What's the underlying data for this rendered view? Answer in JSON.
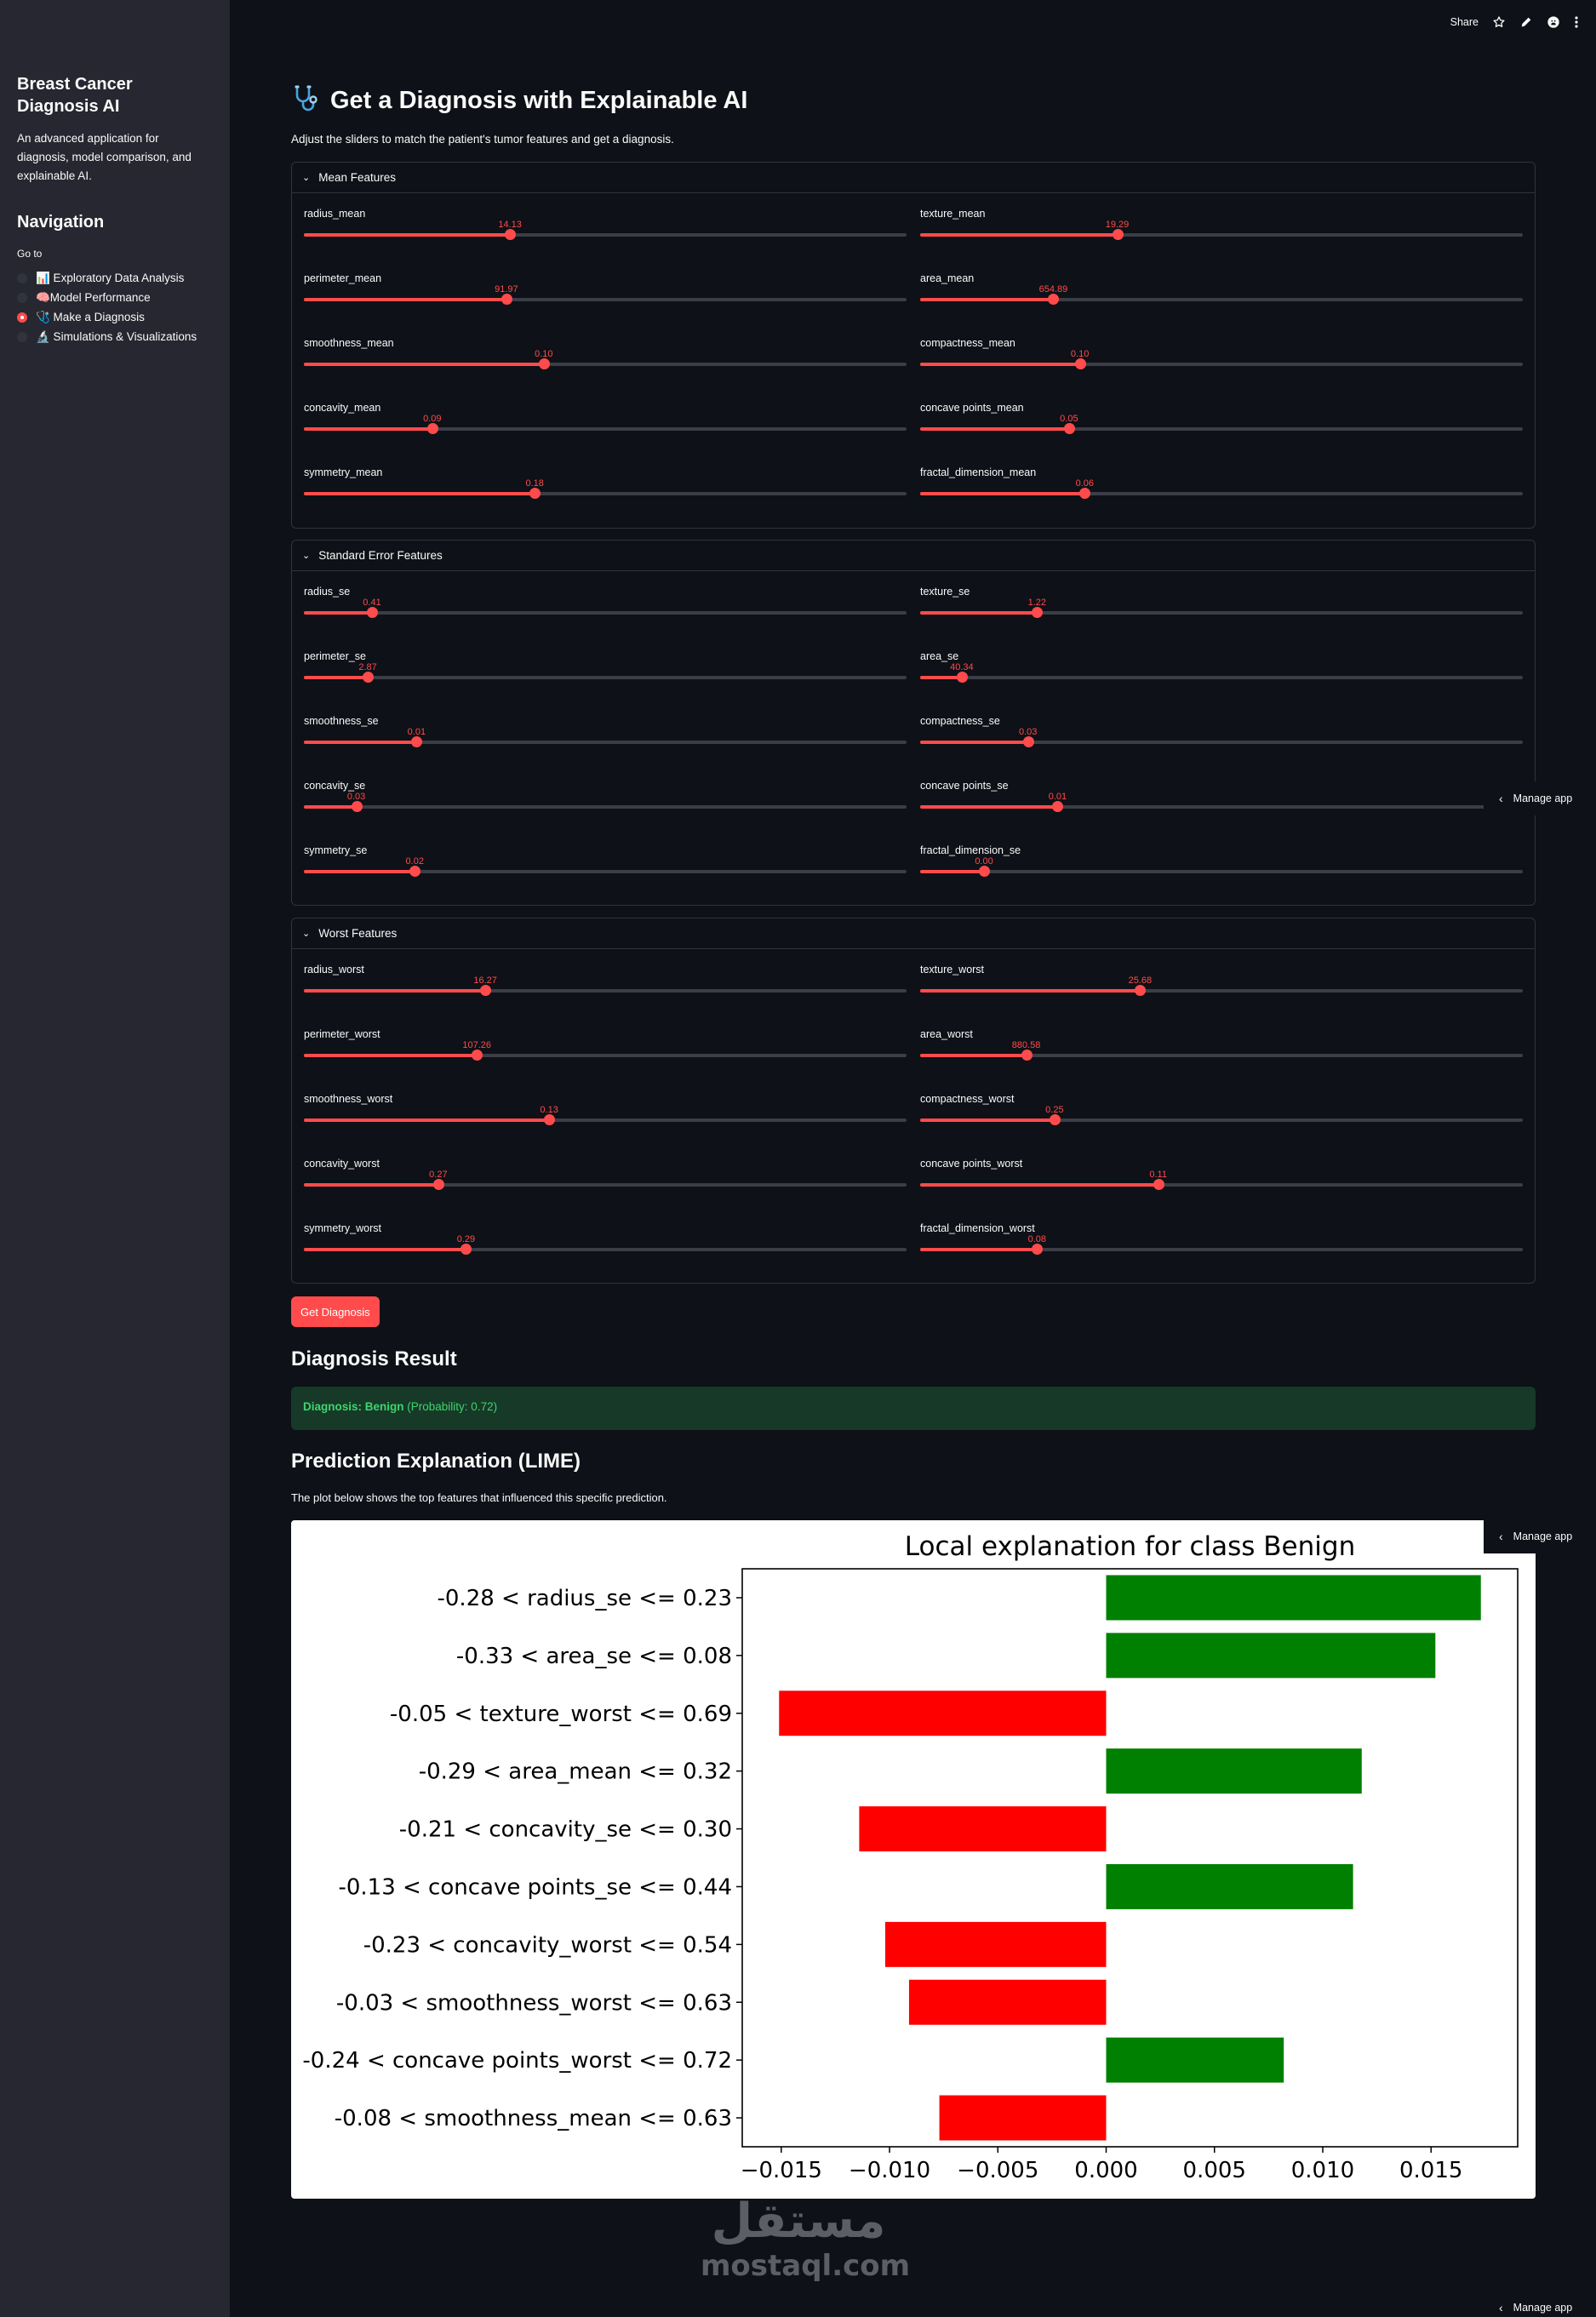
{
  "sidebar": {
    "title": "Breast Cancer Diagnosis AI",
    "description": "An advanced application for diagnosis, model comparison, and explainable AI.",
    "nav_title": "Navigation",
    "goto_label": "Go to",
    "options": [
      {
        "label": "📊 Exploratory Data Analysis",
        "selected": false
      },
      {
        "label": "🧠Model Performance",
        "selected": false
      },
      {
        "label": "🩺 Make a Diagnosis",
        "selected": true
      },
      {
        "label": "🔬 Simulations & Visualizations",
        "selected": false
      }
    ]
  },
  "toolbar": {
    "share_label": "Share",
    "icons": [
      "star-icon",
      "edit-icon",
      "github-icon",
      "more-icon"
    ]
  },
  "header": {
    "icon": "stethoscope-icon",
    "title": "Get a Diagnosis with Explainable AI",
    "subtitle": "Adjust the sliders to match the patient's tumor features and get a diagnosis."
  },
  "sections": [
    {
      "title": "Mean Features",
      "sliders": [
        {
          "label": "radius_mean",
          "value": "14.13",
          "fraction": 0.342
        },
        {
          "label": "texture_mean",
          "value": "19.29",
          "fraction": 0.327
        },
        {
          "label": "perimeter_mean",
          "value": "91.97",
          "fraction": 0.336
        },
        {
          "label": "area_mean",
          "value": "654.89",
          "fraction": 0.221
        },
        {
          "label": "smoothness_mean",
          "value": "0.10",
          "fraction": 0.398
        },
        {
          "label": "compactness_mean",
          "value": "0.10",
          "fraction": 0.265
        },
        {
          "label": "concavity_mean",
          "value": "0.09",
          "fraction": 0.213
        },
        {
          "label": "concave points_mean",
          "value": "0.05",
          "fraction": 0.247
        },
        {
          "label": "symmetry_mean",
          "value": "0.18",
          "fraction": 0.383
        },
        {
          "label": "fractal_dimension_mean",
          "value": "0.06",
          "fraction": 0.273
        }
      ]
    },
    {
      "title": "Standard Error Features",
      "sliders": [
        {
          "label": "radius_se",
          "value": "0.41",
          "fraction": 0.113
        },
        {
          "label": "texture_se",
          "value": "1.22",
          "fraction": 0.194
        },
        {
          "label": "perimeter_se",
          "value": "2.87",
          "fraction": 0.106
        },
        {
          "label": "area_se",
          "value": "40.34",
          "fraction": 0.069
        },
        {
          "label": "smoothness_se",
          "value": "0.01",
          "fraction": 0.187
        },
        {
          "label": "compactness_se",
          "value": "0.03",
          "fraction": 0.179
        },
        {
          "label": "concavity_se",
          "value": "0.03",
          "fraction": 0.087
        },
        {
          "label": "concave points_se",
          "value": "0.01",
          "fraction": 0.228
        },
        {
          "label": "symmetry_se",
          "value": "0.02",
          "fraction": 0.184
        },
        {
          "label": "fractal_dimension_se",
          "value": "0.00",
          "fraction": 0.106
        }
      ]
    },
    {
      "title": "Worst Features",
      "sliders": [
        {
          "label": "radius_worst",
          "value": "16.27",
          "fraction": 0.301
        },
        {
          "label": "texture_worst",
          "value": "25.68",
          "fraction": 0.365
        },
        {
          "label": "perimeter_worst",
          "value": "107.26",
          "fraction": 0.287
        },
        {
          "label": "area_worst",
          "value": "880.58",
          "fraction": 0.176
        },
        {
          "label": "smoothness_worst",
          "value": "0.13",
          "fraction": 0.407
        },
        {
          "label": "compactness_worst",
          "value": "0.25",
          "fraction": 0.223
        },
        {
          "label": "concavity_worst",
          "value": "0.27",
          "fraction": 0.223
        },
        {
          "label": "concave points_worst",
          "value": "0.11",
          "fraction": 0.395
        },
        {
          "label": "symmetry_worst",
          "value": "0.29",
          "fraction": 0.269
        },
        {
          "label": "fractal_dimension_worst",
          "value": "0.08",
          "fraction": 0.194
        }
      ]
    }
  ],
  "diagnose_button": "Get Diagnosis",
  "result": {
    "heading": "Diagnosis Result",
    "diagnosis": "Diagnosis: Benign",
    "probability": "(Probability: 0.72)"
  },
  "explanation": {
    "heading": "Prediction Explanation (LIME)",
    "description": "The plot below shows the top features that influenced this specific prediction."
  },
  "chart_data": {
    "type": "bar",
    "orientation": "horizontal",
    "title": "Local explanation for class Benign",
    "xlabel": "",
    "ylabel": "",
    "categories": [
      "-0.28 < radius_se <= 0.23",
      "-0.33 < area_se <= 0.08",
      "-0.05 < texture_worst <= 0.69",
      "-0.29 < area_mean <= 0.32",
      "-0.21 < concavity_se <= 0.30",
      "-0.13 < concave points_se <= 0.44",
      "-0.23 < concavity_worst <= 0.54",
      "-0.03 < smoothness_worst <= 0.63",
      "-0.24 < concave points_worst <= 0.72",
      "-0.08 < smoothness_mean <= 0.63"
    ],
    "values": [
      0.0173,
      0.0152,
      -0.0151,
      0.0118,
      -0.0114,
      0.0114,
      -0.0102,
      -0.0091,
      0.0082,
      -0.0077
    ],
    "xlim": [
      -0.0168,
      0.019
    ],
    "xticks": [
      "−0.015",
      "−0.010",
      "−0.005",
      "0.000",
      "0.005",
      "0.010",
      "0.015"
    ],
    "xtick_values": [
      -0.015,
      -0.01,
      -0.005,
      0,
      0.005,
      0.01,
      0.015
    ],
    "positive_color": "#008000",
    "negative_color": "#ff0000",
    "grid": false
  },
  "manage_app_label": "Manage app",
  "watermark": {
    "arabic": "مستقل",
    "latin": "mostaql.com"
  },
  "colors": {
    "accent": "#ff4b4b",
    "background": "#0e1117",
    "sidebar": "#262730",
    "success_bg": "#173928",
    "success_text": "#3dd56d"
  }
}
